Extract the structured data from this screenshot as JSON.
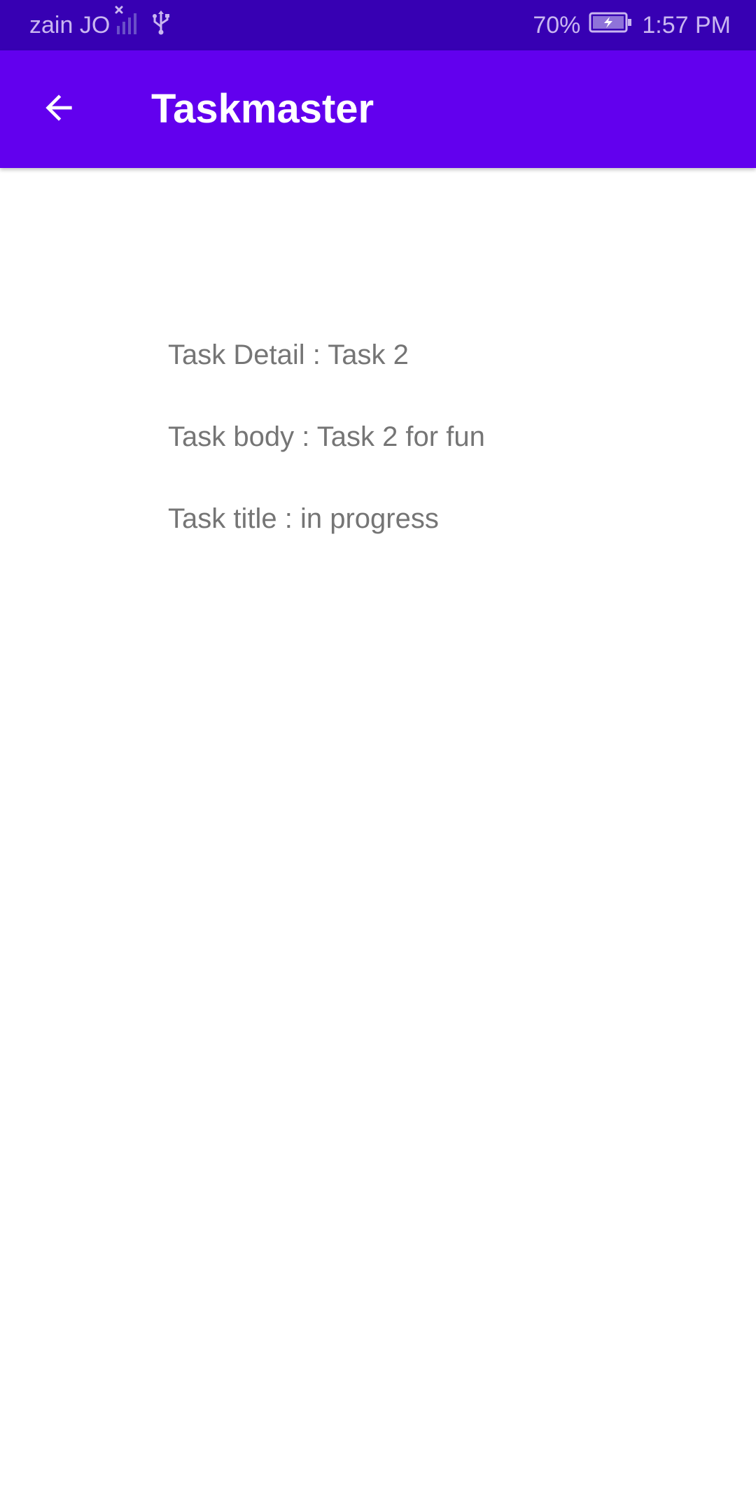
{
  "status_bar": {
    "carrier": "zain JO",
    "battery_percent": "70%",
    "time": "1:57 PM",
    "icons": [
      "signal-no-service-icon",
      "usb-icon",
      "battery-charging-icon"
    ]
  },
  "app_bar": {
    "title": "Taskmaster",
    "back_icon": "arrow-back-icon",
    "color": "#6200ee"
  },
  "details": {
    "task_detail": "Task Detail : Task 2",
    "task_body": "Task body : Task 2 for fun",
    "task_title": "Task title : in progress"
  },
  "colors": {
    "status_bar": "#3700b3",
    "app_bar": "#6200ee",
    "detail_text": "#757575"
  }
}
